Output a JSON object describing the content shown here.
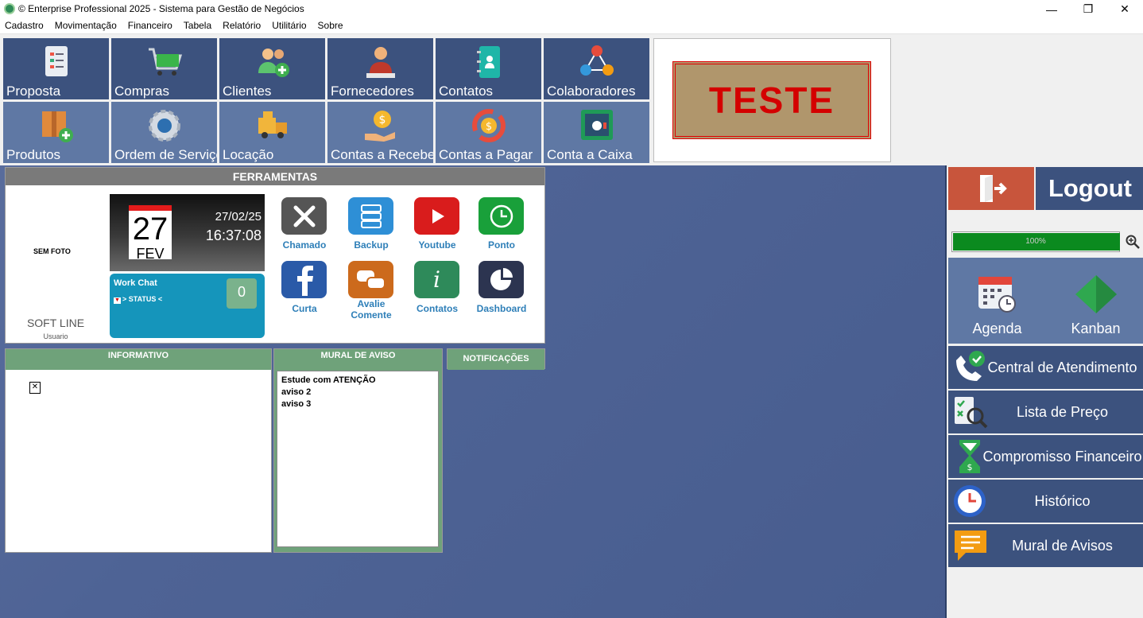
{
  "window": {
    "title": "© Enterprise Professional 2025 - Sistema para Gestão de Negócios",
    "controls": [
      "—",
      "❐",
      "✕"
    ]
  },
  "menu": [
    "Cadastro",
    "Movimentação",
    "Financeiro",
    "Tabela",
    "Relatório",
    "Utilitário",
    "Sobre"
  ],
  "tiles": [
    {
      "label": "Proposta",
      "icon": "proposal-clipboard-icon"
    },
    {
      "label": "Compras",
      "icon": "shopping-cart-icon"
    },
    {
      "label": "Clientes",
      "icon": "add-client-icon"
    },
    {
      "label": "Fornecedores",
      "icon": "supplier-person-icon"
    },
    {
      "label": "Contatos",
      "icon": "contact-book-icon"
    },
    {
      "label": "Colaboradores",
      "icon": "team-network-icon"
    },
    {
      "label": "Produtos",
      "icon": "add-product-box-icon"
    },
    {
      "label": "Ordem de Serviço",
      "icon": "service-gear-icon"
    },
    {
      "label": "Locação",
      "icon": "rental-truck-icon"
    },
    {
      "label": "Contas a Receber",
      "icon": "receive-money-hand-icon"
    },
    {
      "label": "Contas a Pagar",
      "icon": "pay-money-cycle-icon"
    },
    {
      "label": "Conta a Caixa",
      "icon": "cash-safe-icon"
    }
  ],
  "banner": {
    "text": "TESTE"
  },
  "ferramentas": {
    "title": "FERRAMENTAS",
    "photo_placeholder": "SEM FOTO",
    "user_name": "SOFT LINE",
    "user_role": "Usuario",
    "calendar": {
      "day": "27",
      "month": "FEV",
      "date": "27/02/25",
      "time": "16:37:08"
    },
    "work_chat": {
      "title": "Work Chat",
      "status": "> STATUS <",
      "count": "0"
    },
    "tools": [
      {
        "label": "Chamado",
        "icon": "tools-wrench-icon",
        "color": "#555555"
      },
      {
        "label": "Backup",
        "icon": "database-server-icon",
        "color": "#2e8fd6"
      },
      {
        "label": "Youtube",
        "icon": "youtube-play-icon",
        "color": "#d91c1c"
      },
      {
        "label": "Ponto",
        "icon": "clock-icon",
        "color": "#19a03a"
      },
      {
        "label": "Curta",
        "icon": "facebook-icon",
        "color": "#2a5aa8"
      },
      {
        "label": "Avalie\nComente",
        "icon": "chat-bubbles-icon",
        "color": "#cc6a1c"
      },
      {
        "label": "Contatos",
        "icon": "info-icon",
        "color": "#2e8a5a"
      },
      {
        "label": "Dashboard",
        "icon": "pie-chart-icon",
        "color": "#2c3450"
      }
    ]
  },
  "informativo": {
    "title": "INFORMATIVO"
  },
  "mural": {
    "title": "MURAL DE AVISO",
    "items": [
      "Estude com ATENÇÃO",
      "aviso 2",
      "aviso 3"
    ]
  },
  "notificacoes": {
    "title": "NOTIFICAÇÕES"
  },
  "right_panel": {
    "logout": "Logout",
    "progress_text": "100%",
    "progress_value": 1.0,
    "quick": [
      {
        "label": "Agenda",
        "icon": "calendar-clock-icon"
      },
      {
        "label": "Kanban",
        "icon": "kanban-diamond-icon"
      }
    ],
    "buttons": [
      {
        "label": "Central de Atendimento",
        "icon": "support-phone-icon"
      },
      {
        "label": "Lista de Preço",
        "icon": "price-list-search-icon"
      },
      {
        "label": "Compromisso Financeiro",
        "icon": "finance-hourglass-icon"
      },
      {
        "label": "Histórico",
        "icon": "history-clock-icon"
      },
      {
        "label": "Mural de Avisos",
        "icon": "notice-board-icon"
      }
    ]
  },
  "colors": {
    "tile_dark": "#3c527e",
    "tile_light": "#5f78a4",
    "panel_green": "#6fa27a",
    "logout_red": "#c8553c",
    "progress_green": "#0b8a1f"
  }
}
